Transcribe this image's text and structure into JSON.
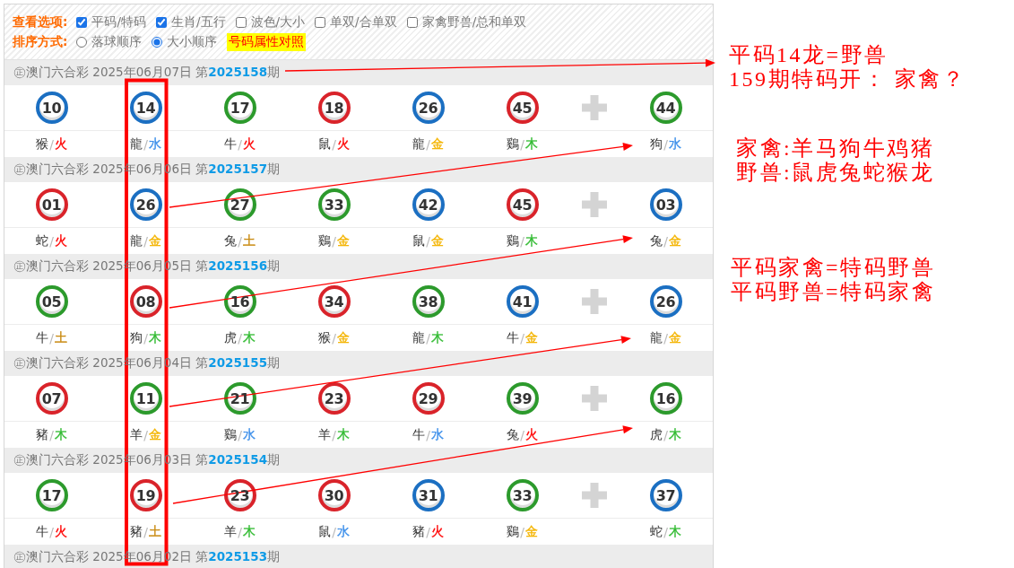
{
  "filters": {
    "label": "查看选项:",
    "options": [
      {
        "label": "平码/特码",
        "checked": true
      },
      {
        "label": "生肖/五行",
        "checked": true
      },
      {
        "label": "波色/大小",
        "checked": false
      },
      {
        "label": "单双/合单双",
        "checked": false
      },
      {
        "label": "家禽野兽/总和单双",
        "checked": false
      }
    ]
  },
  "sorting": {
    "label": "排序方式:",
    "options": [
      {
        "label": "落球顺序",
        "selected": false
      },
      {
        "label": "大小顺序",
        "selected": true
      }
    ],
    "link": "号码属性对照"
  },
  "draws": [
    {
      "header": "㊣澳门六合彩 2025年06月07日 第**2025158**期",
      "numbers": [
        {
          "number": "10",
          "color": "#1b6fc2",
          "attribute": {
            "zodiac": "猴",
            "separator": "/",
            "element": "火",
            "color": "#ff0000"
          }
        },
        {
          "number": "14",
          "color": "#1b6fc2",
          "attribute": {
            "zodiac": "龍",
            "separator": "/",
            "element": "水",
            "color": "#3b8eea"
          }
        },
        {
          "number": "17",
          "color": "#2c9a2c",
          "attribute": {
            "zodiac": "牛",
            "separator": "/",
            "element": "火",
            "color": "#ff0000"
          }
        },
        {
          "number": "18",
          "color": "#d9232a",
          "attribute": {
            "zodiac": "鼠",
            "separator": "/",
            "element": "火",
            "color": "#ff0000"
          }
        },
        {
          "number": "26",
          "color": "#1b6fc2",
          "attribute": {
            "zodiac": "龍",
            "separator": "/",
            "element": "金",
            "color": "#f4b400"
          }
        },
        {
          "number": "45",
          "color": "#d9232a",
          "attribute": {
            "zodiac": "鷄",
            "separator": "/",
            "element": "木",
            "color": "#33bb33"
          }
        }
      ],
      "special": {
        "number": "44",
        "color": "#2c9a2c",
        "attribute": {
          "zodiac": "狗",
          "separator": "/",
          "element": "水",
          "color": "#3b8eea"
        }
      }
    },
    {
      "header": "㊣澳门六合彩 2025年06月06日 第**2025157**期",
      "numbers": [
        {
          "number": "01",
          "color": "#d9232a",
          "attribute": {
            "zodiac": "蛇",
            "separator": "/",
            "element": "火",
            "color": "#ff0000"
          }
        },
        {
          "number": "26",
          "color": "#1b6fc2",
          "attribute": {
            "zodiac": "龍",
            "separator": "/",
            "element": "金",
            "color": "#f4b400"
          }
        },
        {
          "number": "27",
          "color": "#2c9a2c",
          "attribute": {
            "zodiac": "兔",
            "separator": "/",
            "element": "土",
            "color": "#c98a10"
          }
        },
        {
          "number": "33",
          "color": "#2c9a2c",
          "attribute": {
            "zodiac": "鷄",
            "separator": "/",
            "element": "金",
            "color": "#f4b400"
          }
        },
        {
          "number": "42",
          "color": "#1b6fc2",
          "attribute": {
            "zodiac": "鼠",
            "separator": "/",
            "element": "金",
            "color": "#f4b400"
          }
        },
        {
          "number": "45",
          "color": "#d9232a",
          "attribute": {
            "zodiac": "鷄",
            "separator": "/",
            "element": "木",
            "color": "#33bb33"
          }
        }
      ],
      "special": {
        "number": "03",
        "color": "#1b6fc2",
        "attribute": {
          "zodiac": "兔",
          "separator": "/",
          "element": "金",
          "color": "#f4b400"
        }
      }
    },
    {
      "header": "㊣澳门六合彩 2025年06月05日 第**2025156**期",
      "numbers": [
        {
          "number": "05",
          "color": "#2c9a2c",
          "attribute": {
            "zodiac": "牛",
            "separator": "/",
            "element": "土",
            "color": "#c98a10"
          }
        },
        {
          "number": "08",
          "color": "#d9232a",
          "attribute": {
            "zodiac": "狗",
            "separator": "/",
            "element": "木",
            "color": "#33bb33"
          }
        },
        {
          "number": "16",
          "color": "#2c9a2c",
          "attribute": {
            "zodiac": "虎",
            "separator": "/",
            "element": "木",
            "color": "#33bb33"
          }
        },
        {
          "number": "34",
          "color": "#d9232a",
          "attribute": {
            "zodiac": "猴",
            "separator": "/",
            "element": "金",
            "color": "#f4b400"
          }
        },
        {
          "number": "38",
          "color": "#2c9a2c",
          "attribute": {
            "zodiac": "龍",
            "separator": "/",
            "element": "木",
            "color": "#33bb33"
          }
        },
        {
          "number": "41",
          "color": "#1b6fc2",
          "attribute": {
            "zodiac": "牛",
            "separator": "/",
            "element": "金",
            "color": "#f4b400"
          }
        }
      ],
      "special": {
        "number": "26",
        "color": "#1b6fc2",
        "attribute": {
          "zodiac": "龍",
          "separator": "/",
          "element": "金",
          "color": "#f4b400"
        }
      }
    },
    {
      "header": "㊣澳门六合彩 2025年06月04日 第**2025155**期",
      "numbers": [
        {
          "number": "07",
          "color": "#d9232a",
          "attribute": {
            "zodiac": "豬",
            "separator": "/",
            "element": "木",
            "color": "#33bb33"
          }
        },
        {
          "number": "11",
          "color": "#2c9a2c",
          "attribute": {
            "zodiac": "羊",
            "separator": "/",
            "element": "金",
            "color": "#f4b400"
          }
        },
        {
          "number": "21",
          "color": "#2c9a2c",
          "attribute": {
            "zodiac": "鷄",
            "separator": "/",
            "element": "水",
            "color": "#3b8eea"
          }
        },
        {
          "number": "23",
          "color": "#d9232a",
          "attribute": {
            "zodiac": "羊",
            "separator": "/",
            "element": "木",
            "color": "#33bb33"
          }
        },
        {
          "number": "29",
          "color": "#d9232a",
          "attribute": {
            "zodiac": "牛",
            "separator": "/",
            "element": "水",
            "color": "#3b8eea"
          }
        },
        {
          "number": "39",
          "color": "#2c9a2c",
          "attribute": {
            "zodiac": "兔",
            "separator": "/",
            "element": "火",
            "color": "#ff0000"
          }
        }
      ],
      "special": {
        "number": "16",
        "color": "#2c9a2c",
        "attribute": {
          "zodiac": "虎",
          "separator": "/",
          "element": "木",
          "color": "#33bb33"
        }
      }
    },
    {
      "header": "㊣澳门六合彩 2025年06月03日 第**2025154**期",
      "numbers": [
        {
          "number": "17",
          "color": "#2c9a2c",
          "attribute": {
            "zodiac": "牛",
            "separator": "/",
            "element": "火",
            "color": "#ff0000"
          }
        },
        {
          "number": "19",
          "color": "#d9232a",
          "attribute": {
            "zodiac": "豬",
            "separator": "/",
            "element": "土",
            "color": "#c98a10"
          }
        },
        {
          "number": "23",
          "color": "#d9232a",
          "attribute": {
            "zodiac": "羊",
            "separator": "/",
            "element": "木",
            "color": "#33bb33"
          }
        },
        {
          "number": "30",
          "color": "#d9232a",
          "attribute": {
            "zodiac": "鼠",
            "separator": "/",
            "element": "水",
            "color": "#3b8eea"
          }
        },
        {
          "number": "31",
          "color": "#1b6fc2",
          "attribute": {
            "zodiac": "豬",
            "separator": "/",
            "element": "火",
            "color": "#ff0000"
          }
        },
        {
          "number": "33",
          "color": "#2c9a2c",
          "attribute": {
            "zodiac": "鷄",
            "separator": "/",
            "element": "金",
            "color": "#f4b400"
          }
        }
      ],
      "special": {
        "number": "37",
        "color": "#1b6fc2",
        "attribute": {
          "zodiac": "蛇",
          "separator": "/",
          "element": "木",
          "color": "#33bb33"
        }
      }
    },
    {
      "header": "㊣澳门六合彩 2025年06月02日 第**2025153**期"
    }
  ],
  "annotations": [
    {
      "lines": [
        "平码14龙=野兽",
        "159期特码开： 家禽？"
      ]
    },
    {
      "lines": [
        "家禽:羊马狗牛鸡猪",
        "野兽:鼠虎兔蛇猴龙"
      ]
    },
    {
      "lines": [
        "平码家禽=特码野兽",
        "平码野兽=特码家禽"
      ]
    }
  ]
}
